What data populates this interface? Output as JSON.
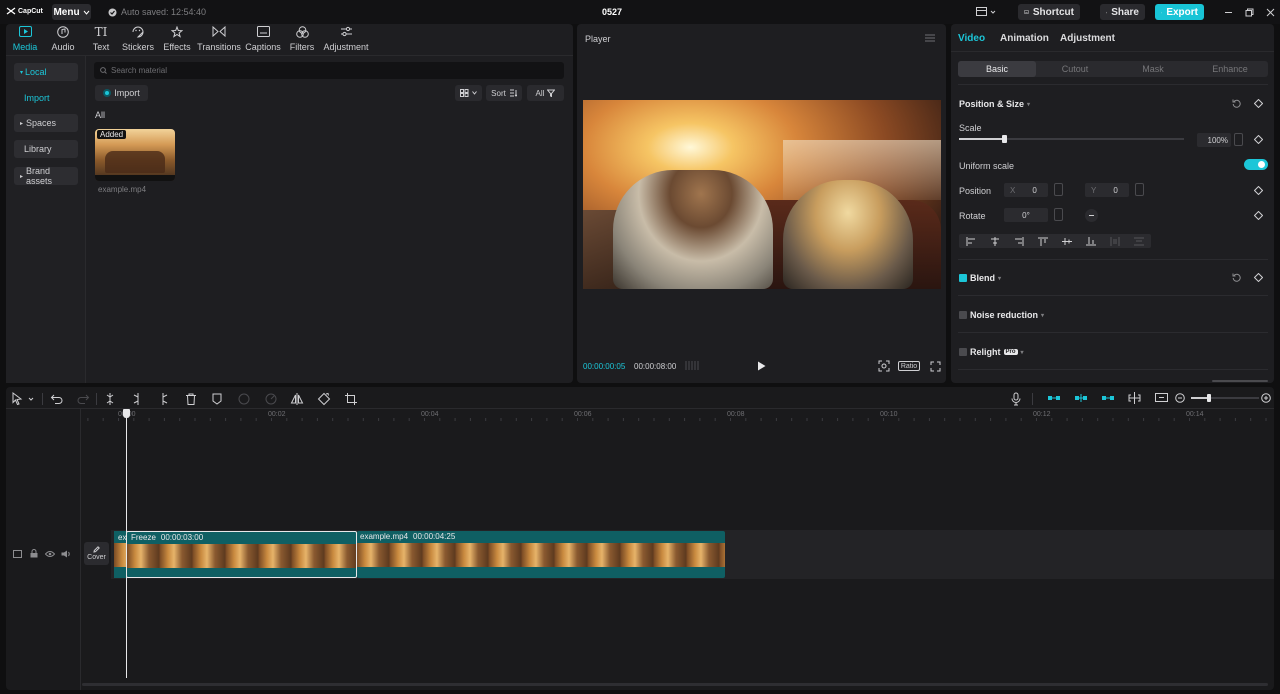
{
  "app": {
    "logo": "CapCut",
    "menu_label": "Menu",
    "autosave": "Auto saved: 12:54:40",
    "project_name": "0527",
    "shortcut_label": "Shortcut",
    "share_label": "Share",
    "export_label": "Export"
  },
  "toolbar": {
    "tabs": [
      {
        "label": "Media",
        "icon": "media-icon"
      },
      {
        "label": "Audio",
        "icon": "audio-icon"
      },
      {
        "label": "Text",
        "icon": "text-icon"
      },
      {
        "label": "Stickers",
        "icon": "stickers-icon"
      },
      {
        "label": "Effects",
        "icon": "effects-icon"
      },
      {
        "label": "Transitions",
        "icon": "transitions-icon"
      },
      {
        "label": "Captions",
        "icon": "captions-icon"
      },
      {
        "label": "Filters",
        "icon": "filters-icon"
      },
      {
        "label": "Adjustment",
        "icon": "adjustment-icon"
      }
    ],
    "text_glyph": "TI"
  },
  "media": {
    "sidebar": [
      "Local",
      "Import",
      "Spaces",
      "Library",
      "Brand assets"
    ],
    "search_placeholder": "Search material",
    "import_label": "Import",
    "sort_label": "Sort",
    "filter_label": "All",
    "section_label": "All",
    "clip": {
      "badge": "Added",
      "name": "example.mp4"
    }
  },
  "player": {
    "title": "Player",
    "current_time": "00:00:00:05",
    "total_time": "00:00:08:00",
    "ratio_label": "Ratio"
  },
  "props": {
    "tabs": [
      "Video",
      "Animation",
      "Adjustment"
    ],
    "subtabs": [
      "Basic",
      "Cutout",
      "Mask",
      "Enhance"
    ],
    "position_size": "Position & Size",
    "scale_label": "Scale",
    "scale_value": "100%",
    "scale_fraction": 0.2,
    "uniform_scale": "Uniform scale",
    "position_label": "Position",
    "pos_x_label": "X",
    "pos_x": "0",
    "pos_y_label": "Y",
    "pos_y": "0",
    "rotate_label": "Rotate",
    "rotate_value": "0°",
    "blend_label": "Blend",
    "noise_label": "Noise reduction",
    "relight_label": "Relight",
    "relight_badge": "Pro"
  },
  "timeline": {
    "ticks": [
      "00:00",
      "00:02",
      "00:04",
      "00:06",
      "00:08",
      "00:10",
      "00:12",
      "00:14"
    ],
    "cover_label": "Cover",
    "clip1": {
      "prefix": "ex",
      "name": "Freeze",
      "duration": "00:00:03:00"
    },
    "clip2": {
      "name": "example.mp4",
      "duration": "00:00:04:25"
    }
  },
  "colors": {
    "accent": "#1cc6d8",
    "clip": "#0f5f63"
  }
}
